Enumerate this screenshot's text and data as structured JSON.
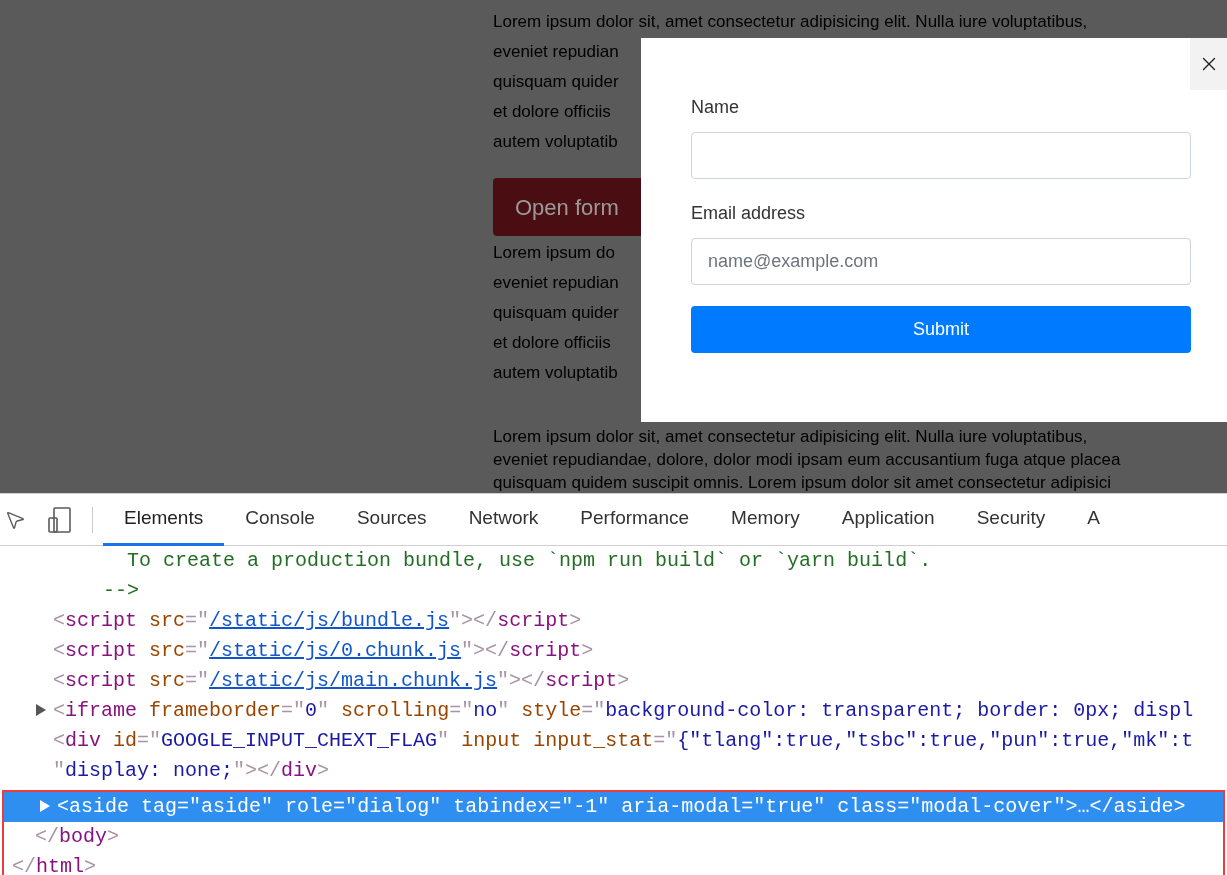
{
  "page": {
    "blocks": [
      {
        "kind": "paragraph",
        "lines": [
          "Lorem ipsum dolor sit, amet consectetur adipisicing elit. Nulla iure voluptatibus,",
          "eveniet repudian",
          "quisquam quider",
          "et dolore officiis",
          "autem voluptatib"
        ]
      },
      {
        "kind": "button",
        "label": "Open form"
      },
      {
        "kind": "paragraph",
        "lines": [
          "Lorem ipsum do",
          "eveniet repudian",
          "quisquam quider",
          "et dolore officiis",
          "autem voluptatib"
        ]
      },
      {
        "kind": "paragraph",
        "lines": [
          "Lorem ipsum dolor sit, amet consectetur adipisicing elit. Nulla iure voluptatibus,",
          "eveniet repudiandae, dolore, dolor modi ipsam eum accusantium fuga atque placea",
          "quisquam quidem suscipit omnis. Lorem ipsum dolor sit amet consectetur adipisici"
        ]
      }
    ]
  },
  "dialog": {
    "fields": [
      {
        "label": "Name"
      },
      {
        "label": "Email address",
        "placeholder": "name@example.com"
      }
    ],
    "submit": "Submit"
  },
  "devtools": {
    "tabs": [
      {
        "label": "Elements",
        "selected": true
      },
      {
        "label": "Console",
        "selected": false
      },
      {
        "label": "Sources",
        "selected": false
      },
      {
        "label": "Network",
        "selected": false
      },
      {
        "label": "Performance",
        "selected": false
      },
      {
        "label": "Memory",
        "selected": false
      },
      {
        "label": "Application",
        "selected": false
      },
      {
        "label": "Security",
        "selected": false
      },
      {
        "label": "A",
        "selected": false
      }
    ],
    "lines": [
      {
        "kind": "comment",
        "expander": false,
        "selected": false,
        "tokens": [
          {
            "kind": "comment",
            "text": "To create a production bundle, use `npm run build` or `yarn build`."
          }
        ]
      },
      {
        "kind": "comment-end",
        "expander": false,
        "selected": false,
        "tokens": [
          {
            "kind": "comment",
            "text": "-->"
          }
        ]
      },
      {
        "kind": "element",
        "expander": false,
        "selected": false,
        "tokens": [
          {
            "kind": "punct",
            "text": "<"
          },
          {
            "kind": "tag",
            "text": "script"
          },
          {
            "kind": "attr",
            "text": " src"
          },
          {
            "kind": "punct",
            "text": "=\""
          },
          {
            "kind": "link",
            "text": "/static/js/bundle.js"
          },
          {
            "kind": "punct",
            "text": "\"></"
          },
          {
            "kind": "tag",
            "text": "script"
          },
          {
            "kind": "punct",
            "text": ">"
          }
        ]
      },
      {
        "kind": "element",
        "expander": false,
        "selected": false,
        "tokens": [
          {
            "kind": "punct",
            "text": "<"
          },
          {
            "kind": "tag",
            "text": "script"
          },
          {
            "kind": "attr",
            "text": " src"
          },
          {
            "kind": "punct",
            "text": "=\""
          },
          {
            "kind": "link",
            "text": "/static/js/0.chunk.js"
          },
          {
            "kind": "punct",
            "text": "\"></"
          },
          {
            "kind": "tag",
            "text": "script"
          },
          {
            "kind": "punct",
            "text": ">"
          }
        ]
      },
      {
        "kind": "element",
        "expander": false,
        "selected": false,
        "tokens": [
          {
            "kind": "punct",
            "text": "<"
          },
          {
            "kind": "tag",
            "text": "script"
          },
          {
            "kind": "attr",
            "text": " src"
          },
          {
            "kind": "punct",
            "text": "=\""
          },
          {
            "kind": "link",
            "text": "/static/js/main.chunk.js"
          },
          {
            "kind": "punct",
            "text": "\"></"
          },
          {
            "kind": "tag",
            "text": "script"
          },
          {
            "kind": "punct",
            "text": ">"
          }
        ]
      },
      {
        "kind": "element",
        "expander": true,
        "selected": false,
        "tokens": [
          {
            "kind": "punct",
            "text": "<"
          },
          {
            "kind": "tag",
            "text": "iframe"
          },
          {
            "kind": "attr",
            "text": " frameborder"
          },
          {
            "kind": "punct",
            "text": "=\""
          },
          {
            "kind": "value",
            "text": "0"
          },
          {
            "kind": "punct",
            "text": "\""
          },
          {
            "kind": "attr",
            "text": " scrolling"
          },
          {
            "kind": "punct",
            "text": "=\""
          },
          {
            "kind": "value",
            "text": "no"
          },
          {
            "kind": "punct",
            "text": "\""
          },
          {
            "kind": "attr",
            "text": " style"
          },
          {
            "kind": "punct",
            "text": "=\""
          },
          {
            "kind": "value",
            "text": "background-color: transparent; border: 0px; displ"
          }
        ]
      },
      {
        "kind": "element",
        "expander": false,
        "selected": false,
        "tokens": [
          {
            "kind": "punct",
            "text": "<"
          },
          {
            "kind": "tag",
            "text": "div"
          },
          {
            "kind": "attr",
            "text": " id"
          },
          {
            "kind": "punct",
            "text": "=\""
          },
          {
            "kind": "value",
            "text": "GOOGLE_INPUT_CHEXT_FLAG"
          },
          {
            "kind": "punct",
            "text": "\""
          },
          {
            "kind": "attr",
            "text": " input input_stat"
          },
          {
            "kind": "punct",
            "text": "=\""
          },
          {
            "kind": "value",
            "text": "{\"tlang\":true,\"tsbc\":true,\"pun\":true,\"mk\":t"
          }
        ]
      },
      {
        "kind": "element",
        "expander": false,
        "selected": false,
        "tokens": [
          {
            "kind": "punct",
            "text": "\""
          },
          {
            "kind": "value",
            "text": "display: none;"
          },
          {
            "kind": "punct",
            "text": "\"></"
          },
          {
            "kind": "tag",
            "text": "div"
          },
          {
            "kind": "punct",
            "text": ">"
          }
        ]
      }
    ],
    "outlined_lines": [
      {
        "kind": "element",
        "expander": true,
        "selected": true,
        "tokens": [
          {
            "kind": "punct",
            "text": "<"
          },
          {
            "kind": "tag",
            "text": "aside"
          },
          {
            "kind": "attr",
            "text": " tag"
          },
          {
            "kind": "punct",
            "text": "=\""
          },
          {
            "kind": "value",
            "text": "aside"
          },
          {
            "kind": "punct",
            "text": "\""
          },
          {
            "kind": "attr",
            "text": " role"
          },
          {
            "kind": "punct",
            "text": "=\""
          },
          {
            "kind": "value",
            "text": "dialog"
          },
          {
            "kind": "punct",
            "text": "\""
          },
          {
            "kind": "attr",
            "text": " tabindex"
          },
          {
            "kind": "punct",
            "text": "=\""
          },
          {
            "kind": "value",
            "text": "-1"
          },
          {
            "kind": "punct",
            "text": "\""
          },
          {
            "kind": "attr",
            "text": " aria-modal"
          },
          {
            "kind": "punct",
            "text": "=\""
          },
          {
            "kind": "value",
            "text": "true"
          },
          {
            "kind": "punct",
            "text": "\""
          },
          {
            "kind": "attr",
            "text": " class"
          },
          {
            "kind": "punct",
            "text": "=\""
          },
          {
            "kind": "value",
            "text": "modal-cover"
          },
          {
            "kind": "punct",
            "text": "\">…</"
          },
          {
            "kind": "tag",
            "text": "aside"
          },
          {
            "kind": "punct",
            "text": ">"
          }
        ]
      },
      {
        "kind": "close-body",
        "expander": false,
        "selected": false,
        "tokens": [
          {
            "kind": "punct",
            "text": "</"
          },
          {
            "kind": "tag",
            "text": "body"
          },
          {
            "kind": "punct",
            "text": ">"
          }
        ]
      },
      {
        "kind": "close-html",
        "expander": false,
        "selected": false,
        "tokens": [
          {
            "kind": "punct",
            "text": "</"
          },
          {
            "kind": "tag",
            "text": "html"
          },
          {
            "kind": "punct",
            "text": ">"
          }
        ]
      }
    ]
  }
}
